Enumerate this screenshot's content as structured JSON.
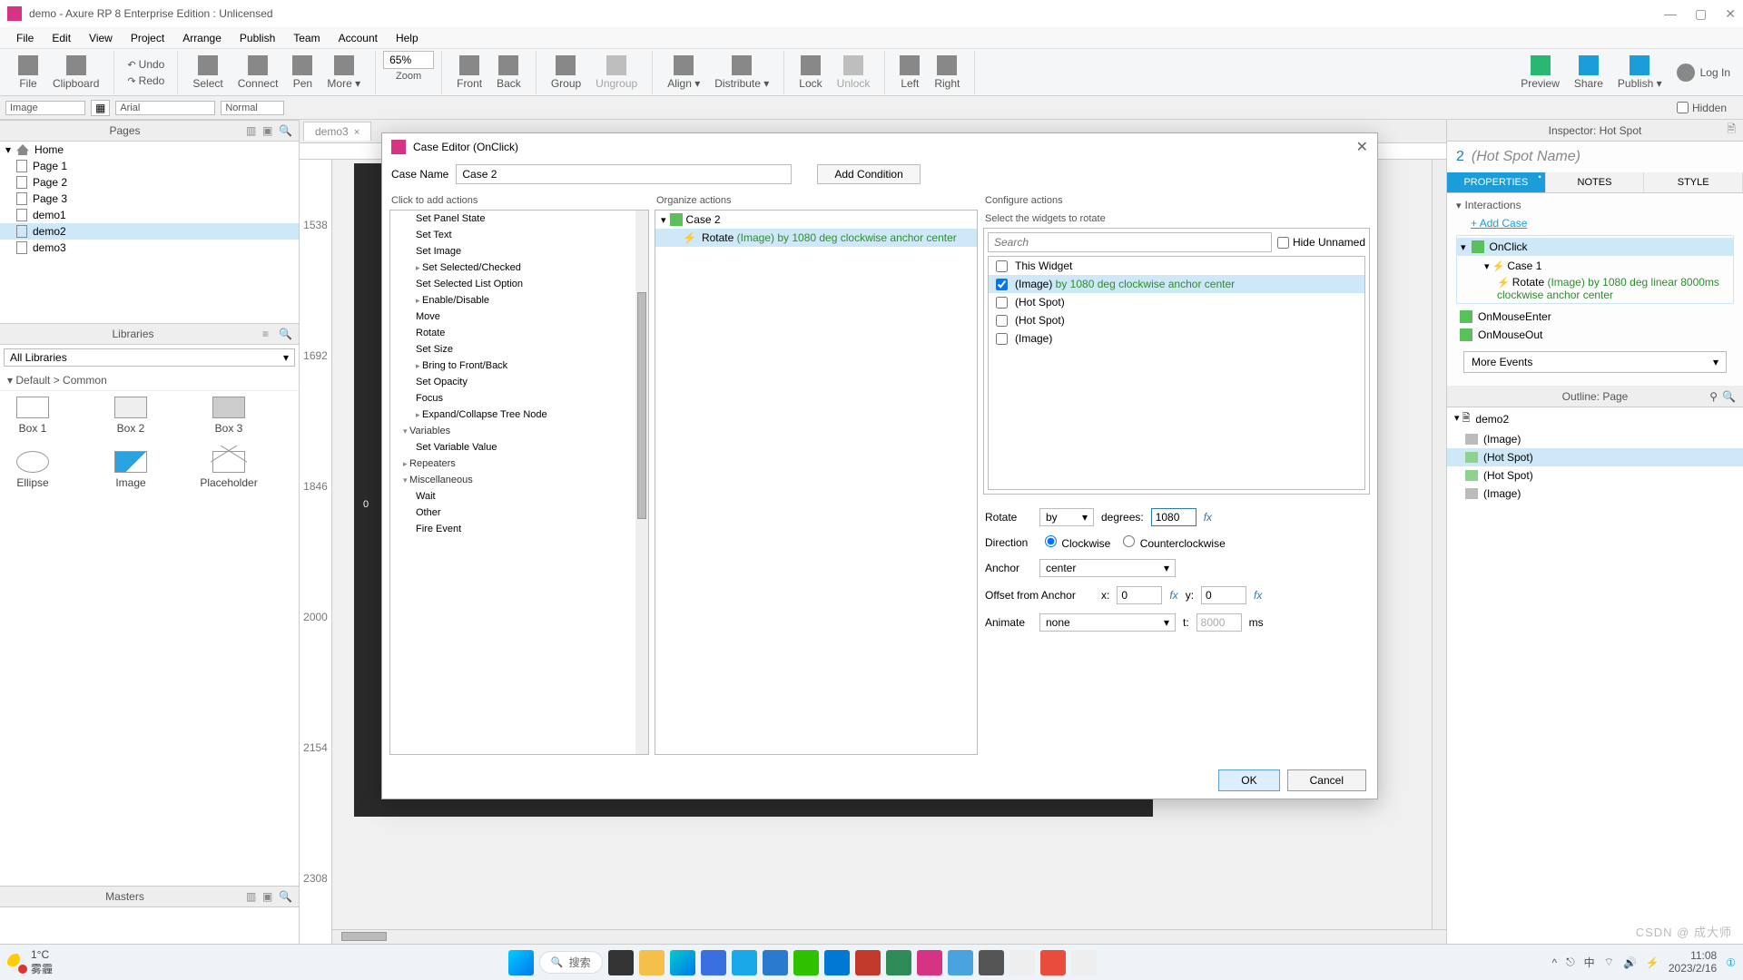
{
  "window": {
    "title": "demo - Axure RP 8 Enterprise Edition : Unlicensed"
  },
  "menubar": [
    "File",
    "Edit",
    "View",
    "Project",
    "Arrange",
    "Publish",
    "Team",
    "Account",
    "Help"
  ],
  "toolbar": {
    "file": "File",
    "clipboard": "Clipboard",
    "undo": "Undo",
    "redo": "Redo",
    "select": "Select",
    "connect": "Connect",
    "pen": "Pen",
    "more": "More ▾",
    "zoom_value": "65%",
    "zoom_label": "Zoom",
    "front": "Front",
    "back": "Back",
    "group": "Group",
    "ungroup": "Ungroup",
    "align": "Align ▾",
    "distribute": "Distribute ▾",
    "lock": "Lock",
    "unlock": "Unlock",
    "left": "Left",
    "right": "Right",
    "preview": "Preview",
    "share": "Share",
    "publish": "Publish ▾",
    "login": "Log In"
  },
  "propbar": {
    "shape": "Image",
    "font": "Arial",
    "style": "Normal",
    "hidden": "Hidden"
  },
  "pages_panel": {
    "title": "Pages",
    "home": "Home",
    "items": [
      "Page 1",
      "Page 2",
      "Page 3",
      "demo1",
      "demo2",
      "demo3"
    ],
    "selected_index": 4
  },
  "libraries_panel": {
    "title": "Libraries",
    "selector": "All Libraries",
    "section": "Default > Common",
    "items": [
      "Box 1",
      "Box 2",
      "Box 3",
      "Ellipse",
      "Image",
      "Placeholder"
    ]
  },
  "masters_panel": {
    "title": "Masters"
  },
  "canvas": {
    "tab": "demo3",
    "ruler_marks": [
      "1538",
      "1692",
      "1846",
      "2000",
      "2154",
      "2308"
    ],
    "zero": "0"
  },
  "inspector": {
    "header": "Inspector: Hot Spot",
    "index": "2",
    "name_placeholder": "(Hot Spot Name)",
    "tabs": [
      "PROPERTIES",
      "NOTES",
      "STYLE"
    ],
    "interactions_label": "Interactions",
    "add_case": "Add Case",
    "events": {
      "onclick": "OnClick",
      "case1": "Case 1",
      "rotate_action_a": "Rotate ",
      "rotate_action_b": "(Image) by 1080 deg linear 8000ms clockwise anchor center",
      "onenter": "OnMouseEnter",
      "onout": "OnMouseOut"
    },
    "more_events": "More Events"
  },
  "outline": {
    "title": "Outline: Page",
    "root": "demo2",
    "items": [
      "(Image)",
      "(Hot Spot)",
      "(Hot Spot)",
      "(Image)"
    ],
    "selected_index": 1
  },
  "modal": {
    "title": "Case Editor (OnClick)",
    "case_name_label": "Case Name",
    "case_name_value": "Case 2",
    "add_condition": "Add Condition",
    "col1_label": "Click to add actions",
    "col2_label": "Organize actions",
    "col3_label": "Configure actions",
    "actions": {
      "set_panel_state": "Set Panel State",
      "set_text": "Set Text",
      "set_image": "Set Image",
      "set_selected": "Set Selected/Checked",
      "set_selected_list": "Set Selected List Option",
      "enable_disable": "Enable/Disable",
      "move": "Move",
      "rotate": "Rotate",
      "set_size": "Set Size",
      "bring": "Bring to Front/Back",
      "set_opacity": "Set Opacity",
      "focus": "Focus",
      "expand": "Expand/Collapse Tree Node",
      "variables": "Variables",
      "set_var": "Set Variable Value",
      "repeaters": "Repeaters",
      "misc": "Miscellaneous",
      "wait": "Wait",
      "other": "Other",
      "fire": "Fire Event"
    },
    "organize": {
      "case": "Case 2",
      "action_a": "Rotate ",
      "action_b": "(Image) by 1080 deg clockwise anchor center"
    },
    "configure": {
      "select_label": "Select the widgets to rotate",
      "search_placeholder": "Search",
      "hide_unnamed": "Hide Unnamed",
      "widgets": [
        {
          "label": "This Widget",
          "checked": false,
          "detail": ""
        },
        {
          "label": "(Image)",
          "checked": true,
          "detail": " by 1080 deg clockwise anchor center"
        },
        {
          "label": "(Hot Spot)",
          "checked": false,
          "detail": ""
        },
        {
          "label": "(Hot Spot)",
          "checked": false,
          "detail": ""
        },
        {
          "label": "(Image)",
          "checked": false,
          "detail": ""
        }
      ],
      "rotate_label": "Rotate",
      "rotate_mode": "by",
      "degrees_label": "degrees:",
      "degrees_value": "1080",
      "direction_label": "Direction",
      "cw": "Clockwise",
      "ccw": "Counterclockwise",
      "anchor_label": "Anchor",
      "anchor_value": "center",
      "offset_label": "Offset from Anchor",
      "x_label": "x:",
      "x_value": "0",
      "y_label": "y:",
      "y_value": "0",
      "animate_label": "Animate",
      "animate_value": "none",
      "t_label": "t:",
      "t_value": "8000",
      "ms": "ms",
      "fx": "fx"
    },
    "ok": "OK",
    "cancel": "Cancel"
  },
  "taskbar": {
    "temp": "1°C",
    "cond": "雾霾",
    "search": "搜索",
    "time": "11:08",
    "date": "2023/2/16",
    "ime": "中"
  },
  "watermark": "CSDN @ 成大师"
}
